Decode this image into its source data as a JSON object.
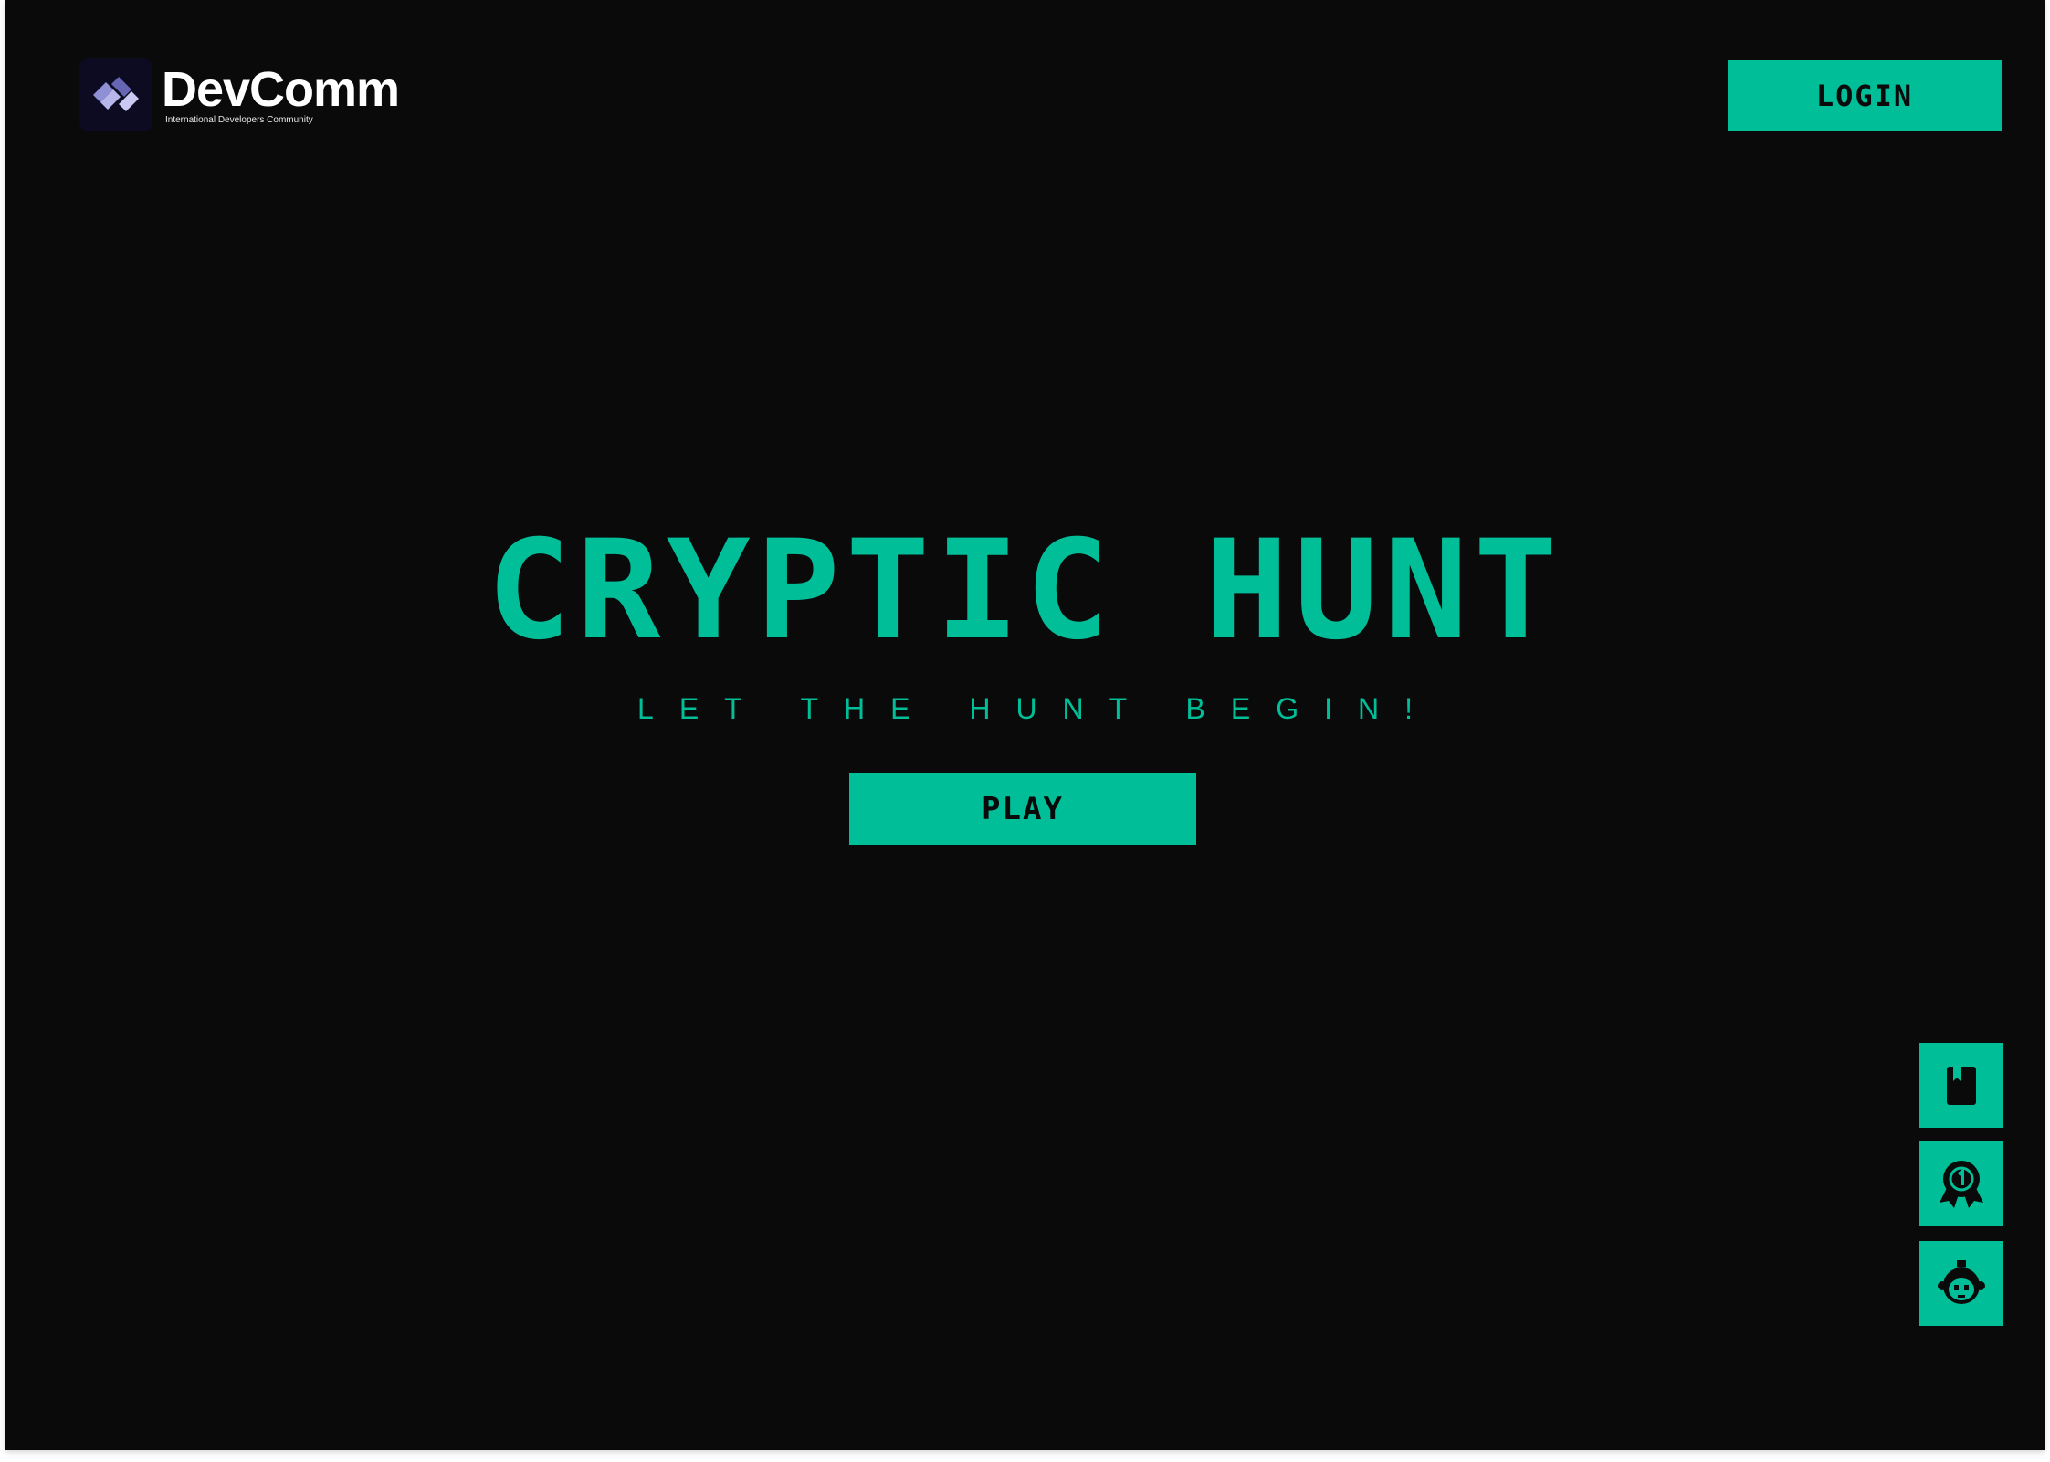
{
  "header": {
    "logo": {
      "name": "DevComm",
      "tagline": "International Developers Community",
      "icon": "devcomm-logo-icon"
    },
    "login_label": "LOGIN"
  },
  "hero": {
    "title": "CRYPTIC HUNT",
    "subtitle": "LET THE HUNT BEGIN!",
    "play_label": "PLAY"
  },
  "side_actions": [
    {
      "icon": "book-icon",
      "label": "Rules"
    },
    {
      "icon": "award-medal-icon",
      "label": "Leaderboard"
    },
    {
      "icon": "avatar-icon",
      "label": "Profile"
    }
  ],
  "colors": {
    "accent": "#00bf98",
    "background": "#0a0a0a",
    "logo_bg": "#0d0b22"
  }
}
